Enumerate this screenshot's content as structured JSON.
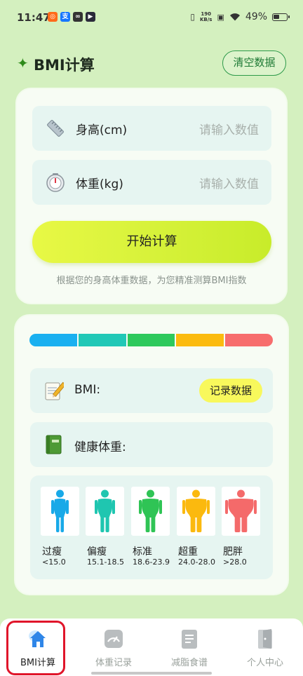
{
  "status_bar": {
    "time": "11:47",
    "net_speed_value": "190",
    "net_speed_unit": "KB/s",
    "battery": "49%"
  },
  "header": {
    "title": "BMI计算",
    "clear_button": "清空数据"
  },
  "input_card": {
    "height": {
      "label": "身高(cm)",
      "placeholder": "请输入数值",
      "icon": "ruler-icon"
    },
    "weight": {
      "label": "体重(kg)",
      "placeholder": "请输入数值",
      "icon": "scale-icon"
    },
    "calc_button": "开始计算",
    "hint": "根据您的身高体重数据，为您精准测算BMI指数"
  },
  "result_card": {
    "scale_colors": [
      "#1ab0f0",
      "#21c8b6",
      "#2ec95c",
      "#fbbb0f",
      "#f76d6d"
    ],
    "bmi_label": "BMI:",
    "record_button": "记录数据",
    "healthy_weight_label": "健康体重:",
    "categories": [
      {
        "name": "过瘦",
        "range": "<15.0",
        "color": "#18a9e8"
      },
      {
        "name": "偏瘦",
        "range": "15.1-18.5",
        "color": "#1fc6b0"
      },
      {
        "name": "标准",
        "range": "18.6-23.9",
        "color": "#2fc455"
      },
      {
        "name": "超重",
        "range": "24.0-28.0",
        "color": "#fbb90e"
      },
      {
        "name": "肥胖",
        "range": ">28.0",
        "color": "#f46a6a"
      }
    ]
  },
  "bottom_nav": {
    "items": [
      {
        "label": "BMI计算",
        "icon": "home-icon",
        "active": true
      },
      {
        "label": "体重记录",
        "icon": "gauge-icon",
        "active": false
      },
      {
        "label": "减脂食谱",
        "icon": "document-icon",
        "active": false
      },
      {
        "label": "个人中心",
        "icon": "door-icon",
        "active": false
      }
    ]
  }
}
